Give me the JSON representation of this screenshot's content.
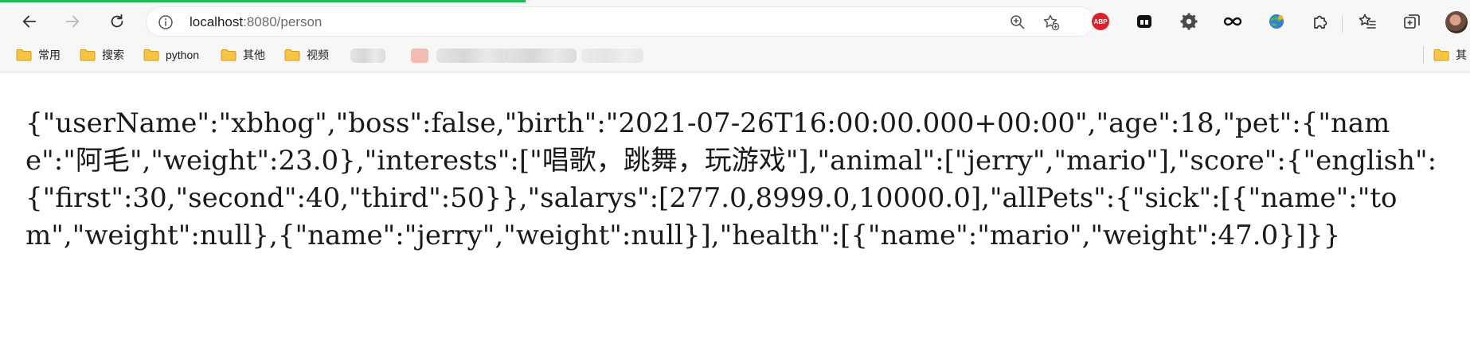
{
  "browser": {
    "url_host": "localhost",
    "url_path": ":8080/person",
    "icons": {
      "back": "back-arrow-icon",
      "forward": "forward-arrow-icon",
      "reload": "reload-icon",
      "site_info": "info-icon",
      "zoom": "zoom-icon",
      "favorite": "favorite-star-icon"
    },
    "extensions": [
      {
        "name": "adblock-plus-icon",
        "label": "ABP"
      },
      {
        "name": "media-extension-icon"
      },
      {
        "name": "settings-gear-icon"
      },
      {
        "name": "infinity-icon"
      },
      {
        "name": "globe-extension-icon"
      },
      {
        "name": "extensions-puzzle-icon"
      },
      {
        "name": "favorites-icon"
      },
      {
        "name": "collections-icon"
      },
      {
        "name": "profile-avatar"
      }
    ],
    "accent_color": "#1db954"
  },
  "bookmarks": {
    "items": [
      {
        "label": "常用"
      },
      {
        "label": "搜索"
      },
      {
        "label": "python"
      },
      {
        "label": "其他"
      },
      {
        "label": "视频"
      }
    ],
    "right_item": {
      "label": "其"
    }
  },
  "content": {
    "json_text": "{\"userName\":\"xbhog\",\"boss\":false,\"birth\":\"2021-07-26T16:00:00.000+00:00\",\"age\":18,\"pet\":{\"name\":\"阿毛\",\"weight\":23.0},\"interests\":[\"唱歌，跳舞，玩游戏\"],\"animal\":[\"jerry\",\"mario\"],\"score\":{\"english\":{\"first\":30,\"second\":40,\"third\":50}},\"salarys\":[277.0,8999.0,10000.0],\"allPets\":{\"sick\":[{\"name\":\"tom\",\"weight\":null},{\"name\":\"jerry\",\"weight\":null}],\"health\":[{\"name\":\"mario\",\"weight\":47.0}]}}"
  }
}
